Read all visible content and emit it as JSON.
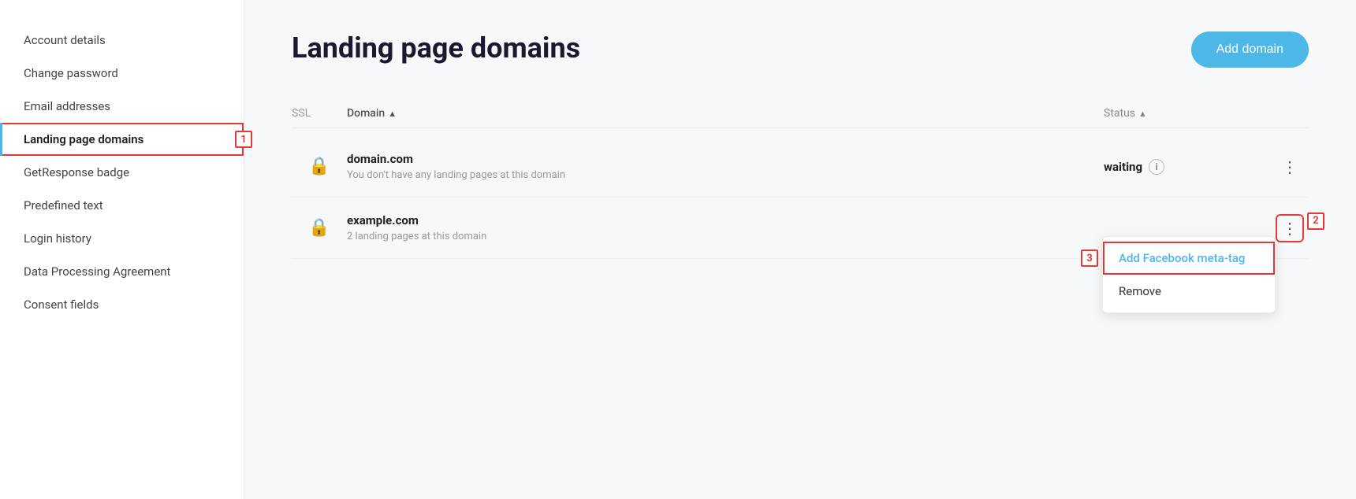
{
  "sidebar": {
    "items": [
      {
        "id": "account-details",
        "label": "Account details",
        "active": false
      },
      {
        "id": "change-password",
        "label": "Change password",
        "active": false
      },
      {
        "id": "email-addresses",
        "label": "Email addresses",
        "active": false
      },
      {
        "id": "landing-page-domains",
        "label": "Landing page domains",
        "active": true
      },
      {
        "id": "getresponse-badge",
        "label": "GetResponse badge",
        "active": false
      },
      {
        "id": "predefined-text",
        "label": "Predefined text",
        "active": false
      },
      {
        "id": "login-history",
        "label": "Login history",
        "active": false
      },
      {
        "id": "data-processing-agreement",
        "label": "Data Processing Agreement",
        "active": false
      },
      {
        "id": "consent-fields",
        "label": "Consent fields",
        "active": false
      }
    ]
  },
  "main": {
    "title": "Landing page domains",
    "add_button_label": "Add domain",
    "table": {
      "columns": {
        "ssl": "SSL",
        "domain": "Domain",
        "domain_sort": "▲",
        "status": "Status",
        "status_sort": "▲"
      },
      "rows": [
        {
          "id": "row1",
          "ssl_locked": true,
          "ssl_color": "gray",
          "domain_name": "domain.com",
          "domain_sub": "You don't have any landing pages at this domain",
          "status": "waiting",
          "has_info": true
        },
        {
          "id": "row2",
          "ssl_locked": true,
          "ssl_color": "green",
          "domain_name": "example.com",
          "domain_sub": "2 landing pages at this domain",
          "status": "",
          "has_info": false
        }
      ]
    },
    "dropdown": {
      "items": [
        {
          "id": "add-facebook-meta-tag",
          "label": "Add Facebook meta-tag",
          "highlighted": true
        },
        {
          "id": "remove",
          "label": "Remove",
          "highlighted": false
        }
      ]
    }
  },
  "annotations": {
    "1": "1",
    "2": "2",
    "3": "3"
  }
}
